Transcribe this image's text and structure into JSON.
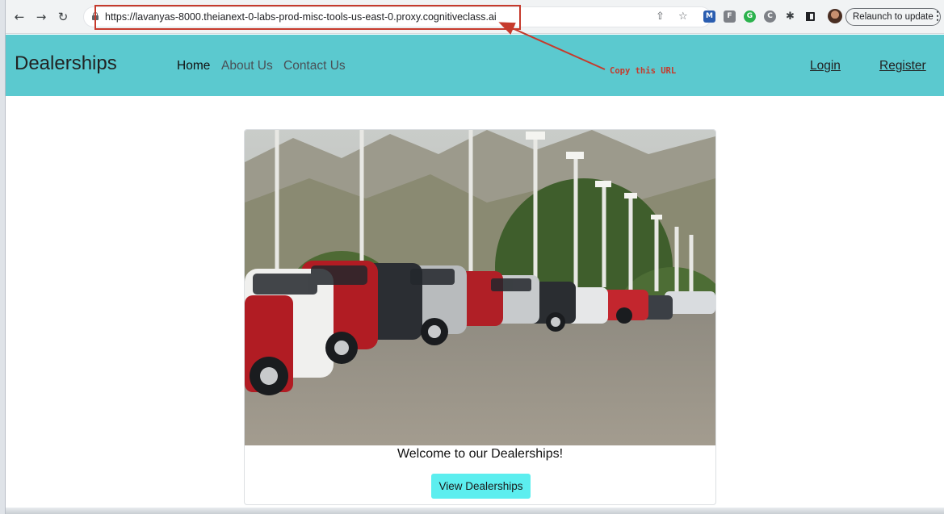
{
  "browser": {
    "url": "https://lavanyas-8000.theianext-0-labs-prod-misc-tools-us-east-0.proxy.cognitiveclass.ai",
    "relaunch_label": "Relaunch to update",
    "icons": [
      "back-icon",
      "forward-icon",
      "reload-icon",
      "lock-icon",
      "share-icon",
      "bookmark-star-icon",
      "puzzle-icon",
      "side-panel-icon",
      "profile-avatar"
    ]
  },
  "annotation": {
    "text": "Copy this URL",
    "color": "#c63a2c"
  },
  "header": {
    "brand": "Dealerships",
    "nav": [
      "Home",
      "About Us",
      "Contact Us"
    ],
    "login": "Login",
    "register": "Register",
    "background": "#5bc9cf"
  },
  "card": {
    "welcome": "Welcome to our Dealerships!",
    "button": "View Dealerships",
    "button_color": "#5ceeef"
  }
}
